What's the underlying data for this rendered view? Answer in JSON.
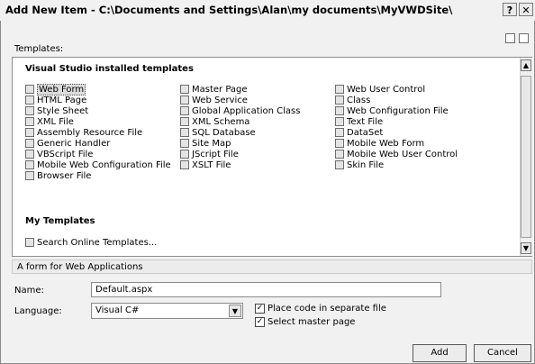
{
  "window": {
    "title": "Add New Item - C:\\Documents and Settings\\Alan\\my documents\\MyVWDSite\\",
    "help_glyph": "?",
    "close_glyph": "✕"
  },
  "templates_label": "Templates:",
  "sections": {
    "installed_title": "Visual Studio installed templates",
    "my_title": "My Templates"
  },
  "columns": [
    [
      "Web Form",
      "HTML Page",
      "Style Sheet",
      "XML File",
      "Assembly Resource File",
      "Generic Handler",
      "VBScript File",
      "Mobile Web Configuration File",
      "Browser File"
    ],
    [
      "Master Page",
      "Web Service",
      "Global Application Class",
      "XML Schema",
      "SQL Database",
      "Site Map",
      "JScript File",
      "XSLT File"
    ],
    [
      "Web User Control",
      "Class",
      "Web Configuration File",
      "Text File",
      "DataSet",
      "Mobile Web Form",
      "Mobile Web User Control",
      "Skin File"
    ]
  ],
  "my_templates": [
    "Search Online Templates..."
  ],
  "description": "A form for Web Applications",
  "form": {
    "name_label": "Name:",
    "name_value": "Default.aspx",
    "language_label": "Language:",
    "language_value": "Visual C#",
    "place_code_label": "Place code in separate file",
    "master_page_label": "Select master page",
    "place_code_checked": true,
    "master_page_checked": true
  },
  "buttons": {
    "add": "Add",
    "cancel": "Cancel"
  },
  "icons": [
    "view-large-icons-icon",
    "view-small-icons-icon",
    "template-icon",
    "scroll-up-icon",
    "scroll-down-icon",
    "dropdown-arrow-icon",
    "checkmark-icon"
  ]
}
